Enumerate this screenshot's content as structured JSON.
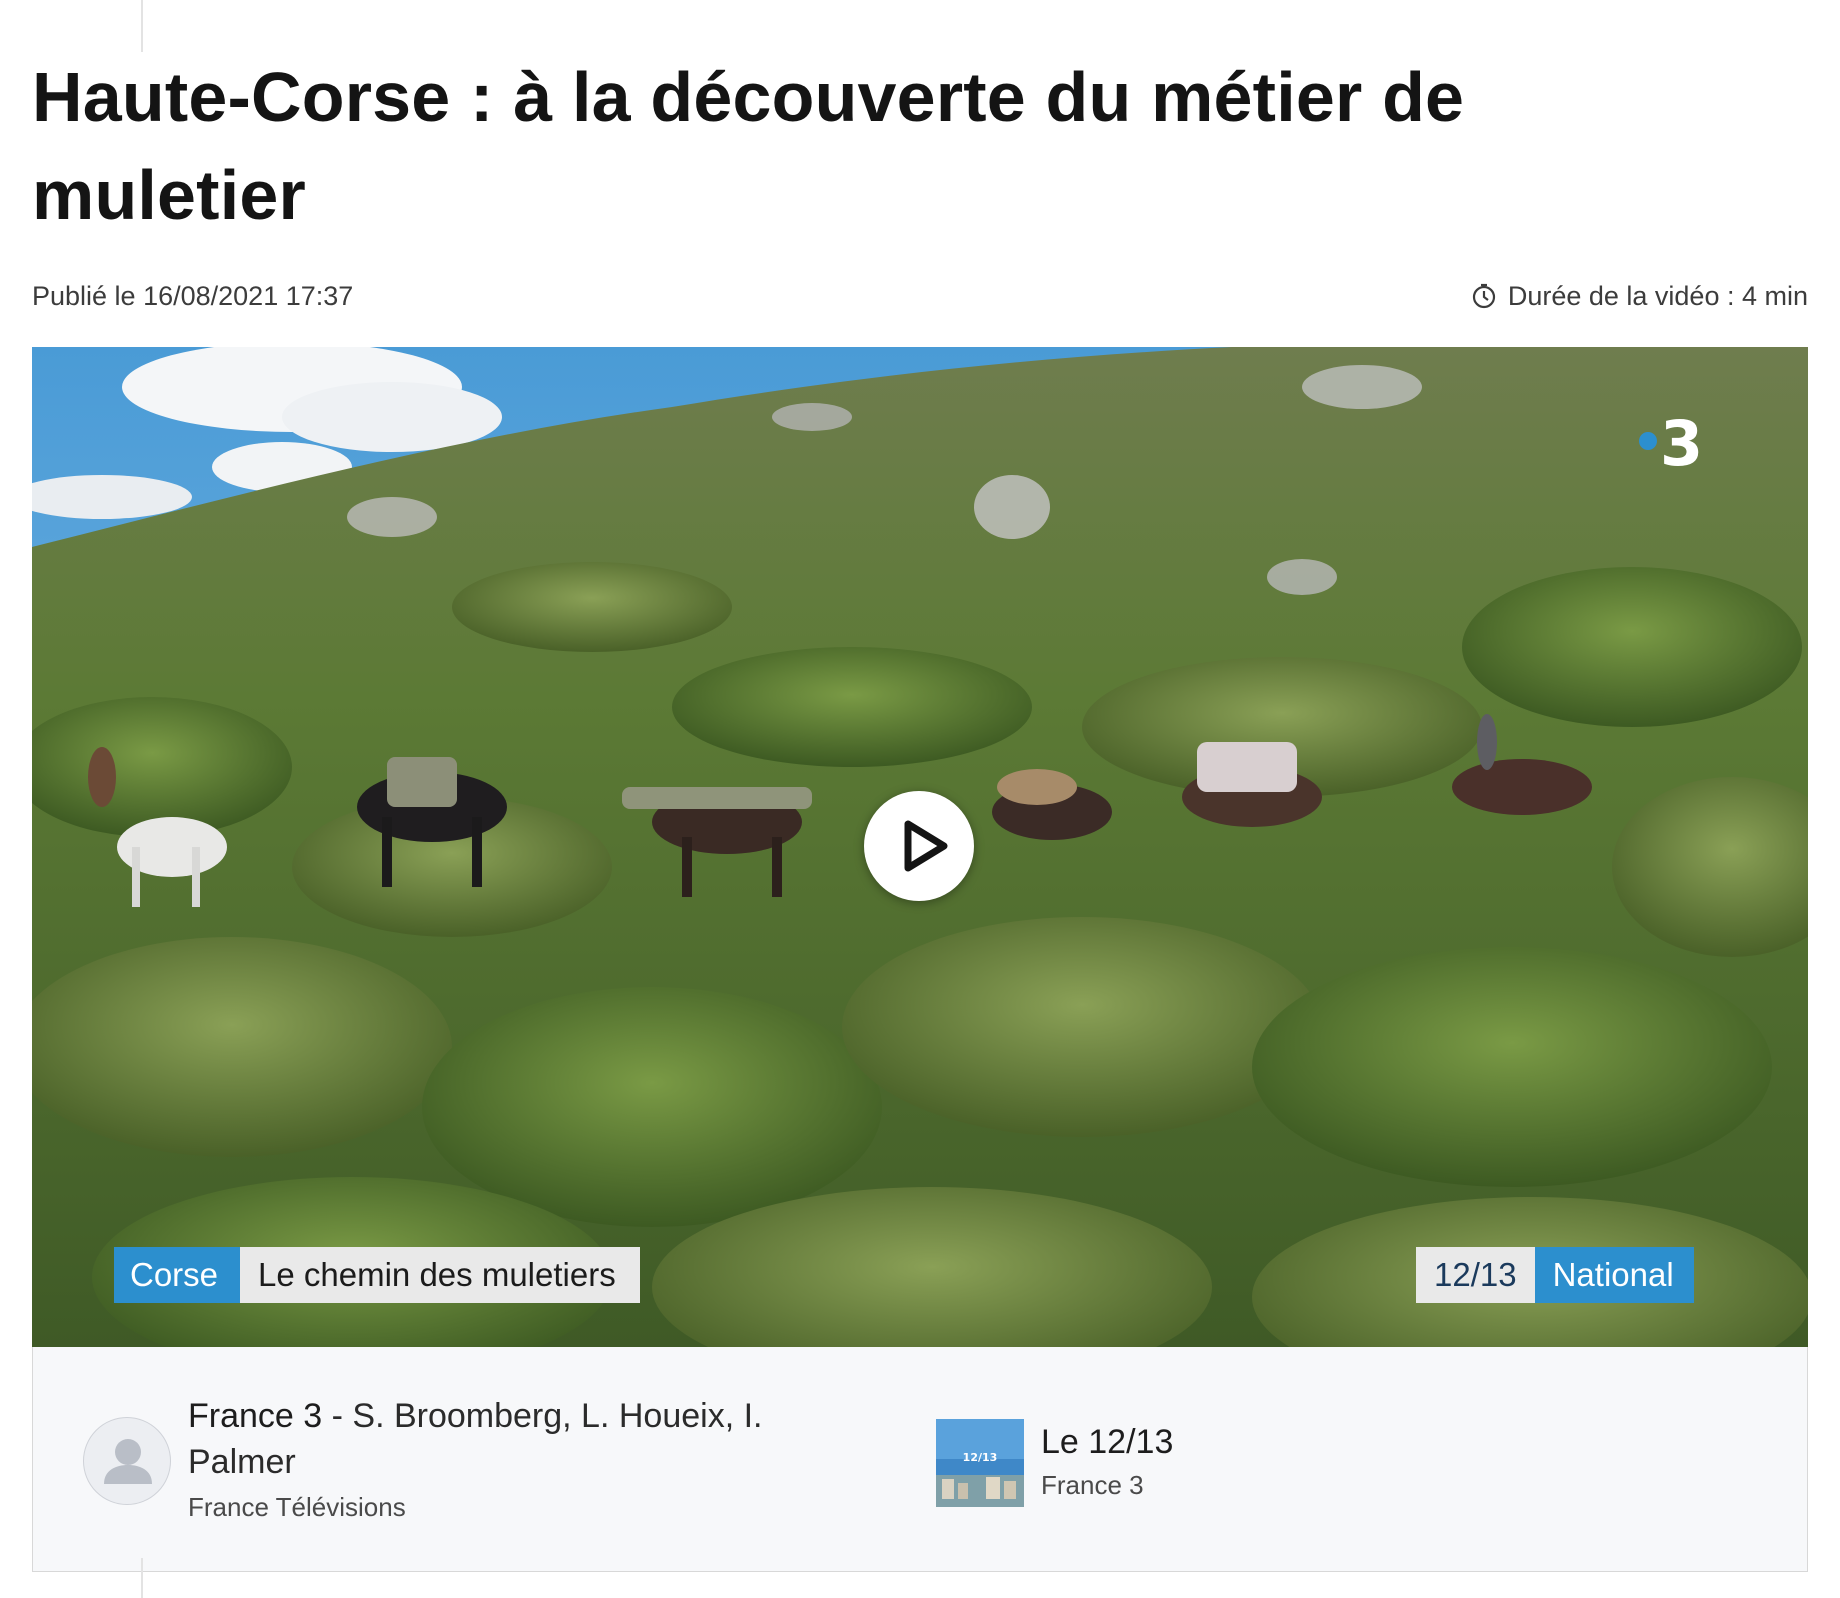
{
  "article": {
    "title": "Haute-Corse : à la découverte du métier de muletier",
    "published": "Publié le 16/08/2021 17:37",
    "duration": "Durée de la vidéo : 4 min"
  },
  "player": {
    "channel_logo_text": "3",
    "caption_region": "Corse",
    "caption_subject": "Le chemin des muletiers",
    "caption_show": "12/13",
    "caption_edition": "National"
  },
  "credits": {
    "outlet": "France 3",
    "separator": " - ",
    "authors": "S. Broomberg, L. Houeix, I. Palmer",
    "organization": "France Télévisions",
    "show_name": "Le 12/13",
    "show_channel": "France 3",
    "show_thumb_text": "12/13"
  },
  "colors": {
    "accent_blue": "#2c8fce",
    "text_dark": "#141414",
    "panel_bg": "#f7f8fa"
  },
  "icons": {
    "duration": "clock-icon",
    "play": "play-icon",
    "avatar": "user-icon"
  }
}
